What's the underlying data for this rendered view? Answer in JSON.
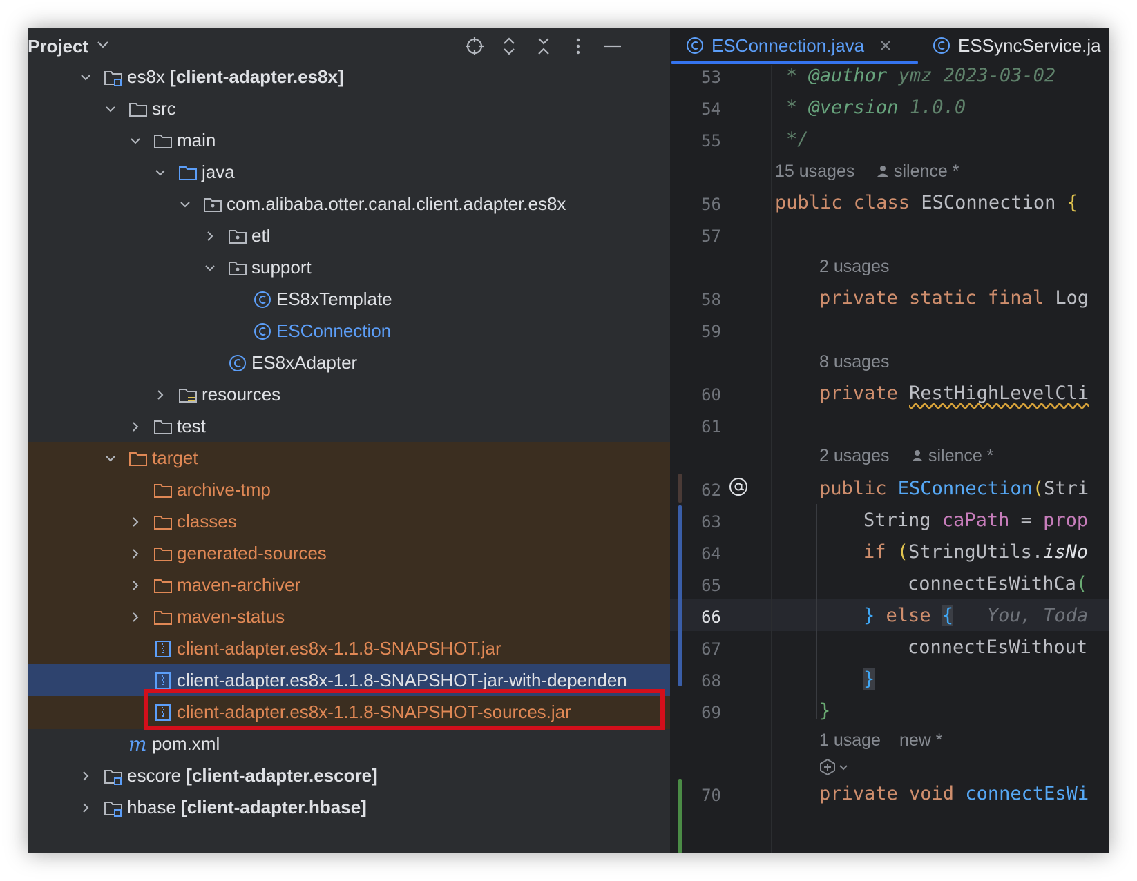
{
  "project_panel": {
    "title": "Project",
    "tree": [
      {
        "name": "es8x",
        "module": "[client-adapter.es8x]"
      },
      {
        "name": "src"
      },
      {
        "name": "main"
      },
      {
        "name": "java"
      },
      {
        "name": "com.alibaba.otter.canal.client.adapter.es8x"
      },
      {
        "name": "etl"
      },
      {
        "name": "support"
      },
      {
        "name": "ES8xTemplate"
      },
      {
        "name": "ESConnection"
      },
      {
        "name": "ES8xAdapter"
      },
      {
        "name": "resources"
      },
      {
        "name": "test"
      },
      {
        "name": "target"
      },
      {
        "name": "archive-tmp"
      },
      {
        "name": "classes"
      },
      {
        "name": "generated-sources"
      },
      {
        "name": "maven-archiver"
      },
      {
        "name": "maven-status"
      },
      {
        "name": "client-adapter.es8x-1.1.8-SNAPSHOT.jar"
      },
      {
        "name": "client-adapter.es8x-1.1.8-SNAPSHOT-jar-with-dependen"
      },
      {
        "name": "client-adapter.es8x-1.1.8-SNAPSHOT-sources.jar"
      },
      {
        "name": "pom.xml"
      },
      {
        "name": "escore",
        "module": "[client-adapter.escore]"
      },
      {
        "name": "hbase",
        "module": "[client-adapter.hbase]"
      }
    ]
  },
  "editor": {
    "tabs": [
      {
        "label": "ESConnection.java",
        "active": true
      },
      {
        "label": "ESSyncService.ja",
        "active": false
      }
    ],
    "line_numbers": {
      "l53": "53",
      "l54": "54",
      "l55": "55",
      "l56": "56",
      "l57": "57",
      "l58": "58",
      "l59": "59",
      "l60": "60",
      "l61": "61",
      "l62": "62",
      "l63": "63",
      "l64": "64",
      "l65": "65",
      "l66": "66",
      "l67": "67",
      "l68": "68",
      "l69": "69",
      "l70": "70"
    },
    "code": {
      "l53_star": "* ",
      "l53_tag": "@author",
      "l53_text": " ymz 2023-03-02",
      "l54_star": "* ",
      "l54_tag": "@version",
      "l54_text": " 1.0.0",
      "l55": "*/",
      "l56_kw": "public class ",
      "l56_name": "ESConnection ",
      "l56_brace": "{",
      "l58_kw": "private static final ",
      "l58_type": "Log",
      "l60_kw": "private ",
      "l60_type": "RestHighLevelCli",
      "l62_kw": "public ",
      "l62_fn": "ESConnection",
      "l62_paren": "(",
      "l62_rest": "Stri",
      "l63_type": "String ",
      "l63_var": "caPath",
      "l63_eq": " = ",
      "l63_rest": "prop",
      "l64_kw": "if ",
      "l64_paren": "(",
      "l64_cls": "StringUtils.",
      "l64_method": "isNo",
      "l65": "connectEsWithCa",
      "l65_paren": "(",
      "l66_brace": "}",
      "l66_kw": " else ",
      "l66_brace2": "{",
      "l66_inlay": "You, Toda",
      "l67": "connectEsWithout",
      "l68": "}",
      "l69": "}",
      "l70_kw": "private void ",
      "l70_fn": "connectEsWi"
    },
    "hints": {
      "h56_usages": "15 usages",
      "h56_author": "silence *",
      "h58_usages": "2 usages",
      "h60_usages": "8 usages",
      "h62_usages": "2 usages",
      "h62_author": "silence *",
      "h70_usages": "1 usage",
      "h70_author": "new *"
    }
  },
  "colors": {
    "panel_bg": "#2b2d30",
    "editor_bg": "#1e1f22",
    "excluded_row_bg": "#3b2e20",
    "selected_row_bg": "#2e436e",
    "highlight_box": "#d40f1b",
    "accent": "#3574f0"
  }
}
